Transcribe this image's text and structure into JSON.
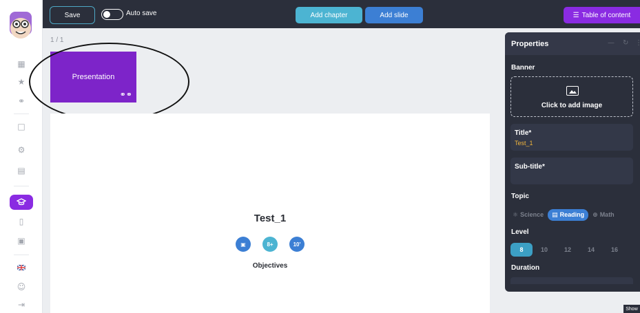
{
  "toolbar": {
    "save_label": "Save",
    "autosave_label": "Auto save",
    "add_chapter_label": "Add chapter",
    "add_slide_label": "Add slide",
    "toc_label": "Table of content",
    "toc_icon": "list-icon"
  },
  "canvas": {
    "page_counter": "1 / 1",
    "thumbnail_label": "Presentation"
  },
  "slide": {
    "title": "Test_1",
    "badges": [
      "▣",
      "8+",
      "10'"
    ],
    "objectives_label": "Objectives"
  },
  "properties": {
    "title": "Properties",
    "banner_label": "Banner",
    "banner_cta": "Click to add image",
    "title_field_label": "Title*",
    "title_field_value": "Test_1",
    "subtitle_field_label": "Sub-title*",
    "topic_label": "Topic",
    "topics": [
      "Science",
      "Reading",
      "Math"
    ],
    "active_topic": "Reading",
    "level_label": "Level",
    "levels": [
      "8",
      "10",
      "12",
      "14",
      "16"
    ],
    "active_level": "8",
    "duration_label": "Duration"
  },
  "footer": {
    "show_label": "Show"
  },
  "colors": {
    "topbar": "#2b2f3b",
    "accent_purple": "#8a2be2",
    "accent_blue": "#3c7fd4",
    "accent_cyan": "#4cb4d2",
    "title_value": "#f0b43c"
  },
  "sidebar_icons": [
    "logo-avatar-icon",
    "grid-icon",
    "star-icon",
    "binoculars-icon",
    "document-icon",
    "settings-icon",
    "newspaper-icon",
    "graduation-cap-icon",
    "tablet-icon",
    "robot-icon",
    "flag-icon",
    "user-settings-icon",
    "logout-icon"
  ]
}
